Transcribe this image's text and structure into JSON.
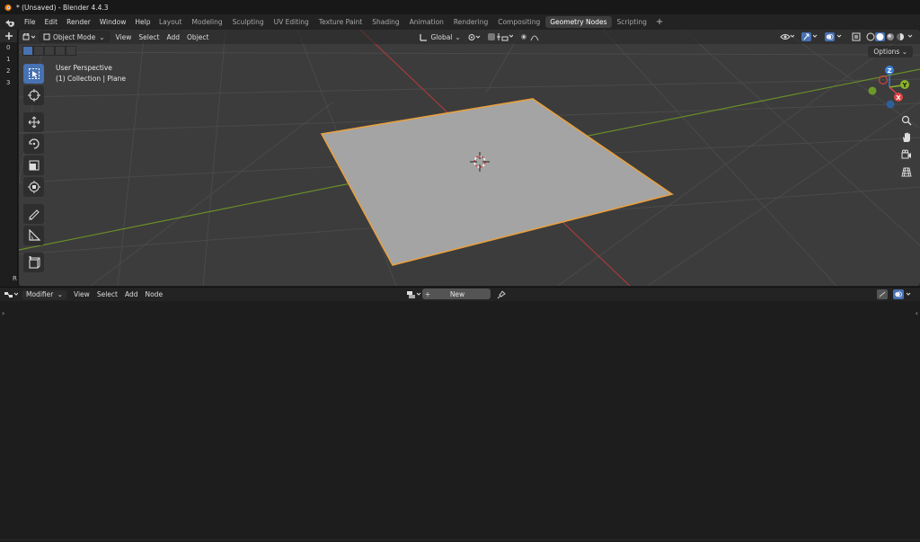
{
  "window": {
    "title": "* (Unsaved) - Blender 4.4.3"
  },
  "menubar": {
    "items": [
      "File",
      "Edit",
      "Render",
      "Window",
      "Help"
    ],
    "workspace_tabs": [
      "Layout",
      "Modeling",
      "Sculpting",
      "UV Editing",
      "Texture Paint",
      "Shading",
      "Animation",
      "Rendering",
      "Compositing",
      "Geometry Nodes",
      "Scripting"
    ],
    "active_tab": "Geometry Nodes",
    "add_tab": "+"
  },
  "left_strip": {
    "numbers": [
      "0",
      "1",
      "2",
      "3"
    ],
    "bottom_letter": "R"
  },
  "viewport": {
    "mode": "Object Mode",
    "menus": [
      "View",
      "Select",
      "Add",
      "Object"
    ],
    "transform_orientation": "Global",
    "options_label": "Options",
    "info_line1": "User Perspective",
    "info_line2": "(1) Collection | Plane",
    "gizmo": {
      "x": "X",
      "y": "Y",
      "z": "Z"
    },
    "colors": {
      "background": "#3c3c3c",
      "selection_outline": "#e8a040",
      "plane_fill": "#a4a4a4",
      "x_axis": "#a83a3a",
      "y_axis": "#6a8e2a",
      "active_tool": "#4772b3"
    }
  },
  "node_editor": {
    "editor_type": "Modifier",
    "menus": [
      "View",
      "Select",
      "Add",
      "Node"
    ],
    "new_label": "New"
  }
}
